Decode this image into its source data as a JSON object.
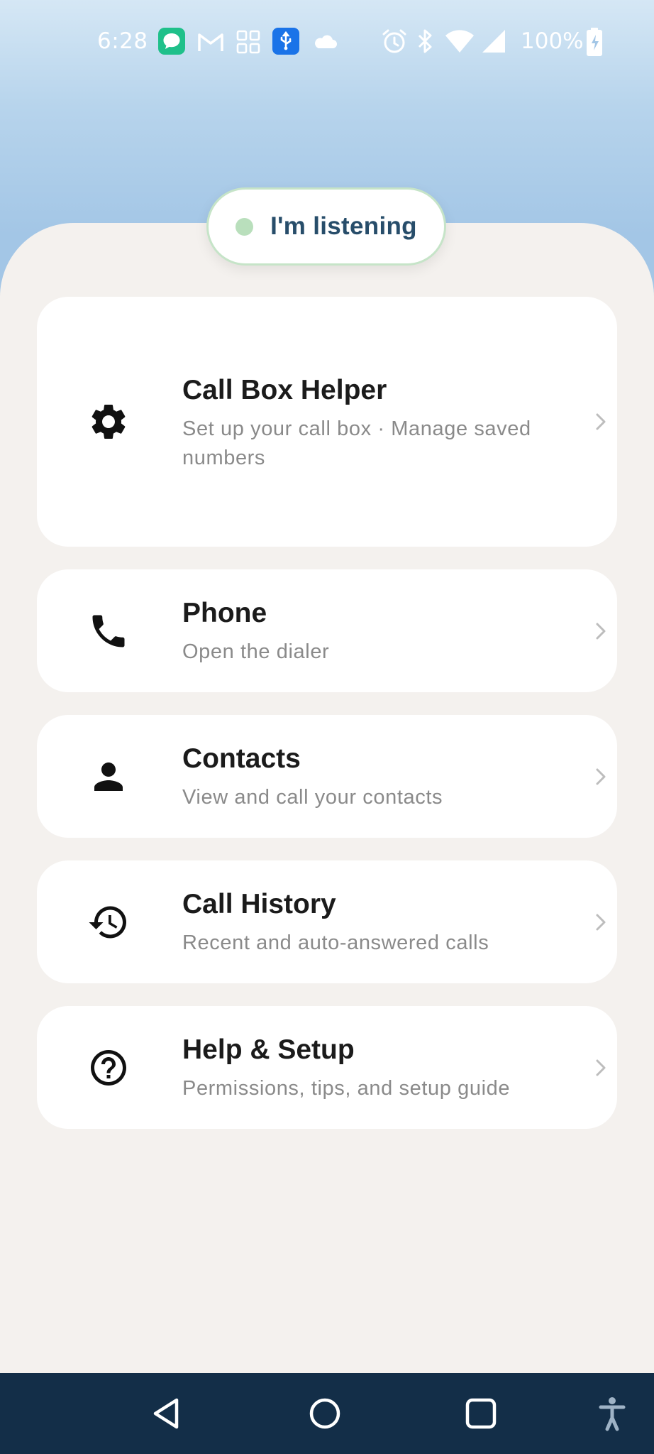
{
  "status_bar": {
    "time": "6:28",
    "battery": "100%",
    "icons": [
      "messages-icon",
      "gmail-icon",
      "app-grid-icon",
      "usb-icon",
      "cloud-icon",
      "alarm-icon",
      "bluetooth-icon",
      "wifi-icon",
      "signal-icon",
      "battery-charging-icon"
    ]
  },
  "listening": {
    "label": "I'm listening",
    "dot_color": "#b9dfbc"
  },
  "menu": [
    {
      "id": "call-box-helper",
      "title": "Call Box Helper",
      "subtitle": "Set up your call box · Manage saved numbers",
      "icon": "gear-icon"
    },
    {
      "id": "phone",
      "title": "Phone",
      "subtitle": "Open the dialer",
      "icon": "phone-icon"
    },
    {
      "id": "contacts",
      "title": "Contacts",
      "subtitle": "View and call your contacts",
      "icon": "person-icon"
    },
    {
      "id": "call-history",
      "title": "Call History",
      "subtitle": "Recent and auto-answered calls",
      "icon": "history-icon"
    },
    {
      "id": "help-setup",
      "title": "Help & Setup",
      "subtitle": "Permissions, tips, and setup guide",
      "icon": "help-icon"
    }
  ],
  "nav": [
    "back-icon",
    "home-icon",
    "recents-icon",
    "accessibility-icon"
  ],
  "colors": {
    "accent_text": "#274d6a",
    "sheet_bg": "#f4f1ee",
    "nav_bg": "#132e48",
    "sky": "#a3c6e6"
  }
}
